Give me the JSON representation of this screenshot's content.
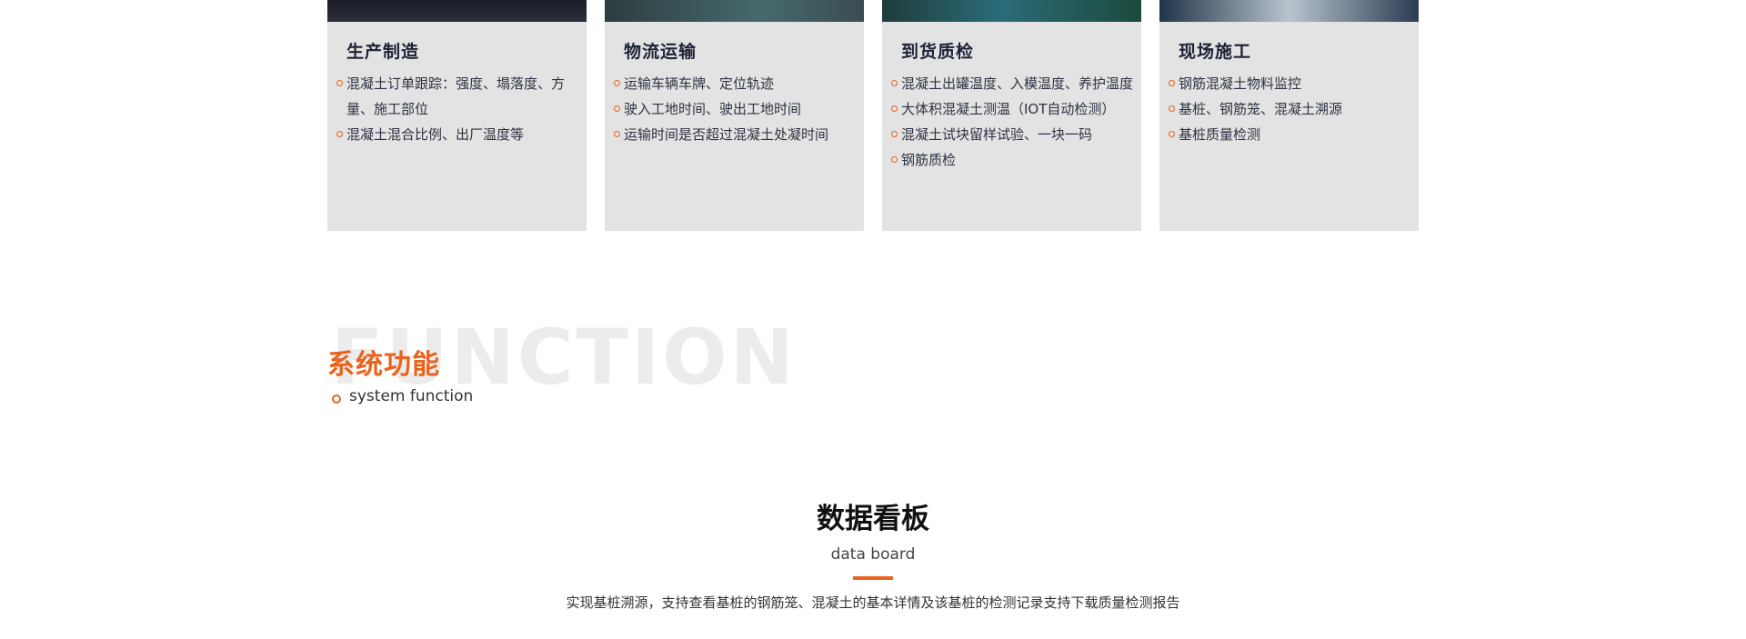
{
  "cards": [
    {
      "title": "生产制造",
      "items": [
        "混凝土订单跟踪：强度、塌落度、方量、施工部位",
        "混凝土混合比例、出厂温度等"
      ]
    },
    {
      "title": "物流运输",
      "items": [
        "运输车辆车牌、定位轨迹",
        "驶入工地时间、驶出工地时间",
        "运输时间是否超过混凝土处凝时间"
      ]
    },
    {
      "title": "到货质检",
      "items": [
        "混凝土出罐温度、入模温度、养护温度",
        "大体积混凝土测温（IOT自动检测）",
        "混凝土试块留样试验、一块一码",
        "钢筋质检"
      ]
    },
    {
      "title": "现场施工",
      "items": [
        "钢筋混凝土物料监控",
        "基桩、钢筋笼、混凝土溯源",
        "基桩质量检测"
      ]
    }
  ],
  "function_section": {
    "bg_text": "FUNCTION",
    "title": "系统功能",
    "subtitle": "system function"
  },
  "board": {
    "title": "数据看板",
    "subtitle": "data board",
    "description": "实现基桩溯源，支持查看基桩的钢筋笼、混凝土的基本详情及该基桩的检测记录支持下载质量检测报告"
  },
  "colors": {
    "accent": "#e8631e",
    "card_bg": "#e3e3e3",
    "heading": "#1d2336"
  }
}
